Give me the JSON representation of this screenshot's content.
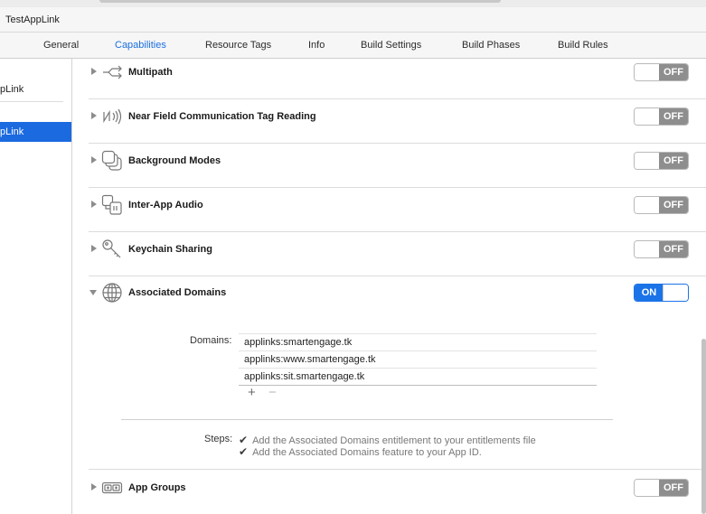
{
  "window": {
    "title": "TestAppLink"
  },
  "tabs": [
    {
      "label": "General"
    },
    {
      "label": "Capabilities"
    },
    {
      "label": "Resource Tags"
    },
    {
      "label": "Info"
    },
    {
      "label": "Build Settings"
    },
    {
      "label": "Build Phases"
    },
    {
      "label": "Build Rules"
    }
  ],
  "sidebar": {
    "items": [
      {
        "label": "pLink"
      },
      {
        "label": "pLink"
      }
    ]
  },
  "capabilities": [
    {
      "name": "Multipath",
      "icon": "multipath-icon",
      "state": "OFF"
    },
    {
      "name": "Near Field Communication Tag Reading",
      "icon": "nfc-icon",
      "state": "OFF"
    },
    {
      "name": "Background Modes",
      "icon": "background-modes-icon",
      "state": "OFF"
    },
    {
      "name": "Inter-App Audio",
      "icon": "inter-app-audio-icon",
      "state": "OFF"
    },
    {
      "name": "Keychain Sharing",
      "icon": "key-icon",
      "state": "OFF"
    },
    {
      "name": "Associated Domains",
      "icon": "globe-icon",
      "state": "ON"
    },
    {
      "name": "App Groups",
      "icon": "app-groups-icon",
      "state": "OFF"
    }
  ],
  "associated_domains": {
    "domains_label": "Domains:",
    "domains": [
      "applinks:smartengage.tk",
      "applinks:www.smartengage.tk",
      "applinks:sit.smartengage.tk"
    ],
    "add_symbol": "+",
    "remove_symbol": "−",
    "steps_label": "Steps:",
    "steps": [
      "Add the Associated Domains entitlement to your entitlements file",
      "Add the Associated Domains feature to your App ID."
    ]
  },
  "colors": {
    "accent": "#1b73e8",
    "toggle_off": "#8e8e8e",
    "selection": "#1b6ae0"
  }
}
